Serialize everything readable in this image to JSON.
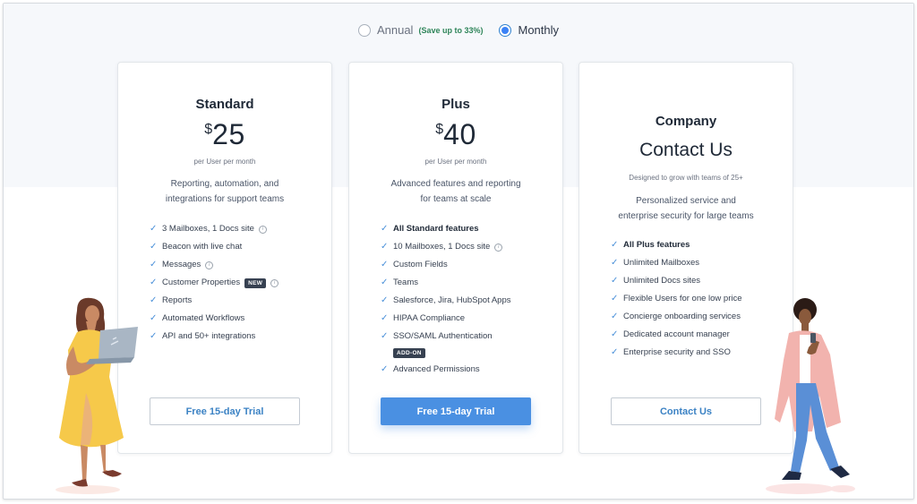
{
  "billing": {
    "annual_label": "Annual",
    "annual_save": "(Save up to 33%)",
    "monthly_label": "Monthly",
    "selected": "Monthly"
  },
  "plans": {
    "standard": {
      "name": "Standard",
      "currency": "$",
      "price": "25",
      "per": "per User per month",
      "desc_line1": "Reporting, automation, and",
      "desc_line2": "integrations for support teams",
      "features": [
        "3 Mailboxes, 1 Docs site",
        "Beacon with live chat",
        "Messages",
        "Customer Properties",
        "Reports",
        "Automated Workflows",
        "API and 50+ integrations"
      ],
      "new_badge": "NEW",
      "button": "Free 15-day Trial"
    },
    "plus": {
      "name": "Plus",
      "currency": "$",
      "price": "40",
      "per": "per User per month",
      "desc_line1": "Advanced features and reporting",
      "desc_line2": "for teams at scale",
      "features": [
        "All Standard features",
        "10 Mailboxes, 1 Docs site",
        "Custom Fields",
        "Teams",
        "Salesforce, Jira, HubSpot Apps",
        "HIPAA Compliance",
        "SSO/SAML Authentication",
        "Advanced Permissions"
      ],
      "addon_badge": "ADD-ON",
      "button": "Free 15-day Trial"
    },
    "company": {
      "name": "Company",
      "title": "Contact Us",
      "subtitle": "Designed to grow with teams of 25+",
      "desc_line1": "Personalized service and",
      "desc_line2": "enterprise security for large teams",
      "features": [
        "All Plus features",
        "Unlimited Mailboxes",
        "Unlimited Docs sites",
        "Flexible Users for one low price",
        "Concierge onboarding services",
        "Dedicated account manager",
        "Enterprise security and SSO"
      ],
      "button": "Contact Us"
    }
  },
  "icons": {
    "check": "check-icon",
    "info": "info-icon"
  },
  "colors": {
    "accent": "#4a90e2",
    "link": "#3b82c4",
    "save_green": "#2f855a",
    "check": "#4a90d9"
  }
}
